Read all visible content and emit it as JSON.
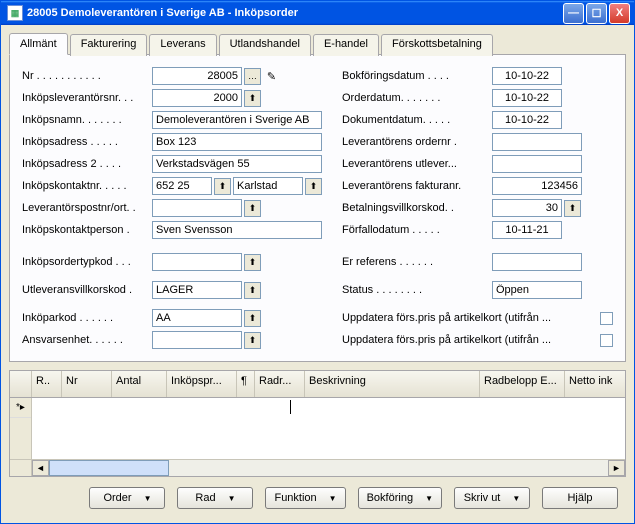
{
  "window": {
    "title": "28005 Demoleverantören i Sverige AB - Inköpsorder"
  },
  "tabs": [
    {
      "label": "Allmänt",
      "underline_index": 0
    },
    {
      "label": "Fakturering",
      "underline_index": 0
    },
    {
      "label": "Leverans",
      "underline_index": 0
    },
    {
      "label": "Utlandshandel",
      "underline_index": 0
    },
    {
      "label": "E-handel",
      "underline_index": 0
    },
    {
      "label": "Förskottsbetalning",
      "underline_index": 0
    }
  ],
  "active_tab": 0,
  "left": {
    "nr_label": "Nr  . . . . . . . . . . .",
    "nr": "28005",
    "inkopsleverantorsnr_label": "Inköpsleverantörsnr. . .",
    "inkopsleverantorsnr": "2000",
    "inkopsnamn_label": "Inköpsnamn. . . . . . .",
    "inkopsnamn": "Demoleverantören i Sverige AB",
    "inkopsadress_label": "Inköpsadress  . . . . .",
    "inkopsadress": "Box 123",
    "inkopsadress2_label": "Inköpsadress 2  . . . .",
    "inkopsadress2": "Verkstadsvägen 55",
    "inkopskontaktnr_label": "Inköpskontaktnr. . . . .",
    "inkopskontaktnr": "652 25",
    "inkopskontaktnr_city": "Karlstad",
    "leverantorspostnrort_label": "Leverantörspostnr/ort. .",
    "leverantorspostnrort": "",
    "inkopskontaktperson_label": "Inköpskontaktperson  .",
    "inkopskontaktperson": "Sven Svensson",
    "inkopsordertypkod_label": "Inköpsordertypkod . . .",
    "inkopsordertypkod": "",
    "utleveransvillkorskod_label": "Utleveransvillkorskod  .",
    "utleveransvillkorskod": "LAGER",
    "inkoparkod_label": "Inköparkod . . . . . .",
    "inkoparkod": "AA",
    "ansvarsenhet_label": "Ansvarsenhet. . . . . .",
    "ansvarsenhet": ""
  },
  "right": {
    "bokforingsdatum_label": "Bokföringsdatum . . . .",
    "bokforingsdatum": "10-10-22",
    "orderdatum_label": "Orderdatum. . . . . . .",
    "orderdatum": "10-10-22",
    "dokumentdatum_label": "Dokumentdatum. . . . .",
    "dokumentdatum": "10-10-22",
    "leverantorens_ordernr_label": "Leverantörens ordernr  .",
    "leverantorens_ordernr": "",
    "leverantorens_utlever_label": "Leverantörens utlever...",
    "leverantorens_utlever": "",
    "leverantorens_fakturanr_label": "Leverantörens fakturanr.",
    "leverantorens_fakturanr": "123456",
    "betalningsvillkorskod_label": "Betalningsvillkorskod. .",
    "betalningsvillkorskod": "30",
    "forfallodatum_label": "Förfallodatum . . . . .",
    "forfallodatum": "10-11-21",
    "er_referens_label": "Er referens  . . . . . .",
    "er_referens": "",
    "status_label": "Status  . . . . . . . .",
    "status": "Öppen",
    "upd1_label": "Uppdatera förs.pris på artikelkort (utifrån ...",
    "upd2_label": "Uppdatera förs.pris på artikelkort (utifrån ..."
  },
  "grid": {
    "headers": [
      "R..",
      "Nr",
      "Antal",
      "Inköpspr...",
      "¶",
      "Radr...",
      "Beskrivning",
      "Radbelopp E...",
      "Netto ink"
    ],
    "row_marker": "*▸"
  },
  "buttons": {
    "order": "Order",
    "rad": "Rad",
    "funktion": "Funktion",
    "bokforing": "Bokföring",
    "skriv_ut": "Skriv ut",
    "hjalp": "Hjälp"
  }
}
